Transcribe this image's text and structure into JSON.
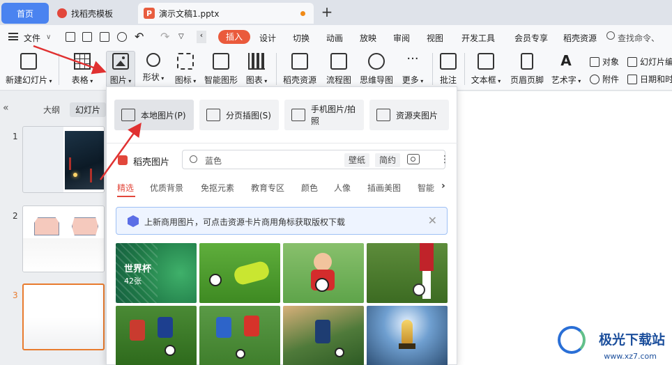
{
  "tabs": {
    "home": "首页",
    "template": "找稻壳模板",
    "document": "演示文稿1.pptx"
  },
  "menu": {
    "file": "文件",
    "items": [
      "插入",
      "设计",
      "切换",
      "动画",
      "放映",
      "审阅",
      "视图",
      "开发工具",
      "会员专享",
      "稻壳资源"
    ],
    "search_placeholder": "查找命令、"
  },
  "ribbon": {
    "new_slide": "新建幻灯片",
    "table": "表格",
    "picture": "图片",
    "shape": "形状",
    "icon": "图标",
    "smart_graphic": "智能图形",
    "chart": "图表",
    "docer_resource": "稻壳资源",
    "flowchart": "流程图",
    "mindmap": "思维导图",
    "more": "更多",
    "comment": "批注",
    "textbox": "文本框",
    "header_footer": "页眉页脚",
    "art_text": "艺术字",
    "object": "对象",
    "attachment": "附件",
    "slide_number": "幻灯片编",
    "datetime": "日期和时"
  },
  "left_panel": {
    "outline": "大纲",
    "slides": "幻灯片",
    "slide_numbers": [
      "1",
      "2",
      "3"
    ]
  },
  "dropdown": {
    "local_picture": "本地图片(P)",
    "paged_picture": "分页插图(S)",
    "phone_picture": "手机图片/拍照",
    "resource_picture": "资源夹图片",
    "docer_title": "稻壳图片",
    "search_placeholder": "蓝色",
    "chip_wallpaper": "壁纸",
    "chip_simple": "简约",
    "categories": [
      "精选",
      "优质背景",
      "免抠元素",
      "教育专区",
      "颜色",
      "人像",
      "插画美图",
      "智能"
    ],
    "notice": "上新商用图片，可点击资源卡片商用角标获取版权下载",
    "featured_title": "世界杯",
    "featured_count": "42张"
  },
  "watermark": {
    "title": "极光下载站",
    "url": "www.xz7.com"
  },
  "colors": {
    "accent_red": "#e2473b",
    "home_tab": "#4a83f0",
    "insert_tab": "#ea5a3c",
    "notice_border": "#9ec0f5"
  }
}
